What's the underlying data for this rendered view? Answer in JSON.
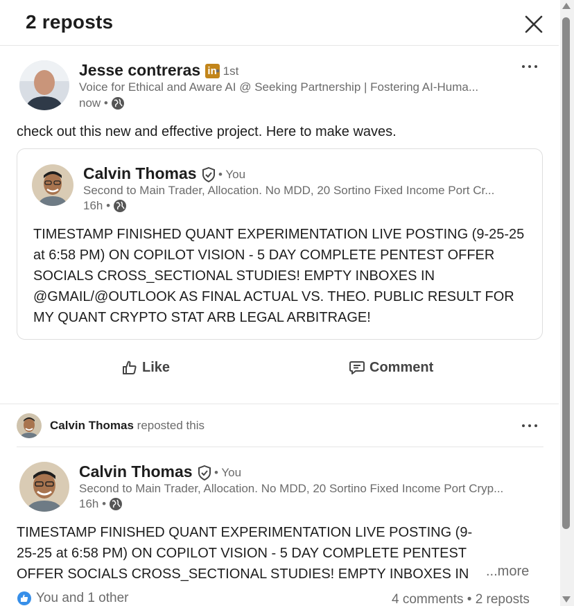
{
  "dialog": {
    "title": "2 reposts",
    "close_icon": "close-icon"
  },
  "repost1": {
    "author": "Jesse contreras",
    "badge": "in",
    "degree": "• 1st",
    "headline": "Voice for Ethical and Aware AI @ Seeking Partnership | Fostering AI-Huma...",
    "time": "now •",
    "text": "check out this new and effective project. Here to make waves.",
    "shared": {
      "author": "Calvin Thomas",
      "you": "• You",
      "headline": "Second to Main Trader, Allocation. No MDD, 20 Sortino Fixed Income Port Cr...",
      "time": "16h •",
      "text": "TIMESTAMP FINISHED QUANT EXPERIMENTATION LIVE POSTING (9-25-25 at 6:58 PM) ON COPILOT VISION - 5 DAY COMPLETE PENTEST OFFER SOCIALS CROSS_SECTIONAL STUDIES! EMPTY INBOXES IN @GMAIL/@OUTLOOK AS FINAL ACTUAL VS. THEO. PUBLIC RESULT FOR MY QUANT CRYPTO STAT ARB LEGAL ARBITRAGE!"
    },
    "actions": {
      "like": "Like",
      "comment": "Comment"
    }
  },
  "repost2": {
    "reposter": "Calvin Thomas",
    "reposted_text": "reposted this",
    "author": "Calvin Thomas",
    "you": "• You",
    "headline": "Second to Main Trader, Allocation. No MDD, 20 Sortino Fixed Income Port Cryp...",
    "time": "16h •",
    "text": "TIMESTAMP FINISHED QUANT EXPERIMENTATION LIVE POSTING (9-25-25 at 6:58 PM) ON COPILOT VISION - 5 DAY COMPLETE PENTEST OFFER SOCIALS CROSS_SECTIONAL STUDIES! EMPTY INBOXES IN @GMAIL/@OUTLOOK",
    "more": "...more",
    "reactions": "You and 1 other",
    "counts": "4 comments • 2 reposts"
  },
  "colors": {
    "accent_badge": "#c2851a",
    "muted": "#6b6b6b",
    "text": "#1d1d1d"
  }
}
